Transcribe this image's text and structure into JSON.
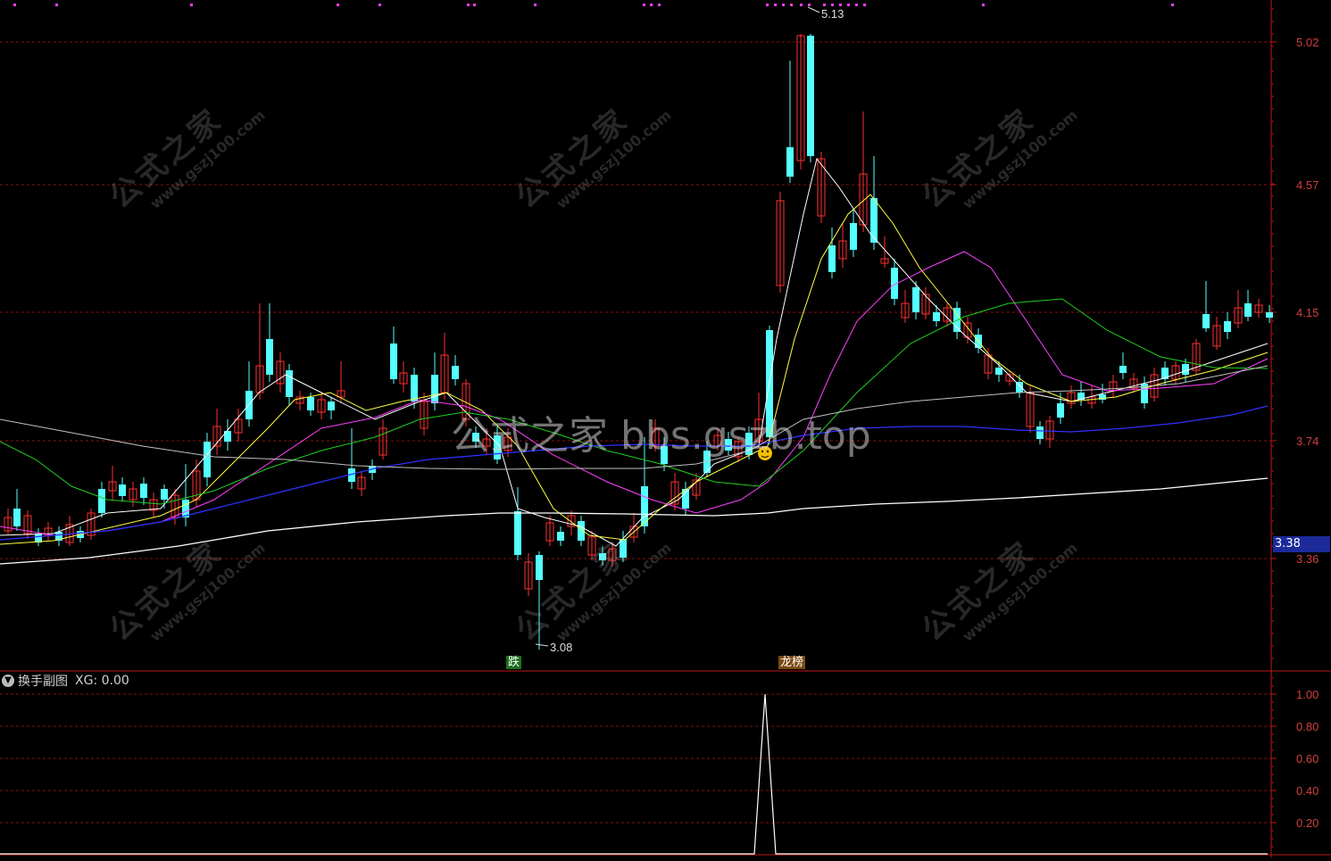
{
  "main_chart": {
    "y_labels": [
      "5.02",
      "4.57",
      "4.15",
      "3.74",
      "3.36"
    ],
    "high_marker": "5.13",
    "low_marker": "3.08",
    "current_price": "3.38",
    "tags": [
      {
        "text": "跌",
        "color": "#1f6e1f"
      },
      {
        "text": "龙榜",
        "color": "#7a4a10"
      }
    ],
    "center_watermark": "公式之家 bbs.gszb.top",
    "watermark": {
      "cn": "公式之家",
      "url": "www.gszj100.com"
    }
  },
  "sub_chart": {
    "title": "换手副图",
    "indicator_label": "XG: 0.00",
    "y_labels": [
      "1.00",
      "0.80",
      "0.60",
      "0.40",
      "0.20"
    ]
  },
  "colors": {
    "up": "#ff3030",
    "down": "#54ffff",
    "grid": "#8b1010",
    "axis": "#c01818",
    "ma5": "#ffffff",
    "ma10": "#ffff40",
    "ma20": "#ff40ff",
    "ma30": "#20d020",
    "ma60": "#3030ff",
    "ma120": "#c0c0c0",
    "ma250": "#ffffff"
  }
}
